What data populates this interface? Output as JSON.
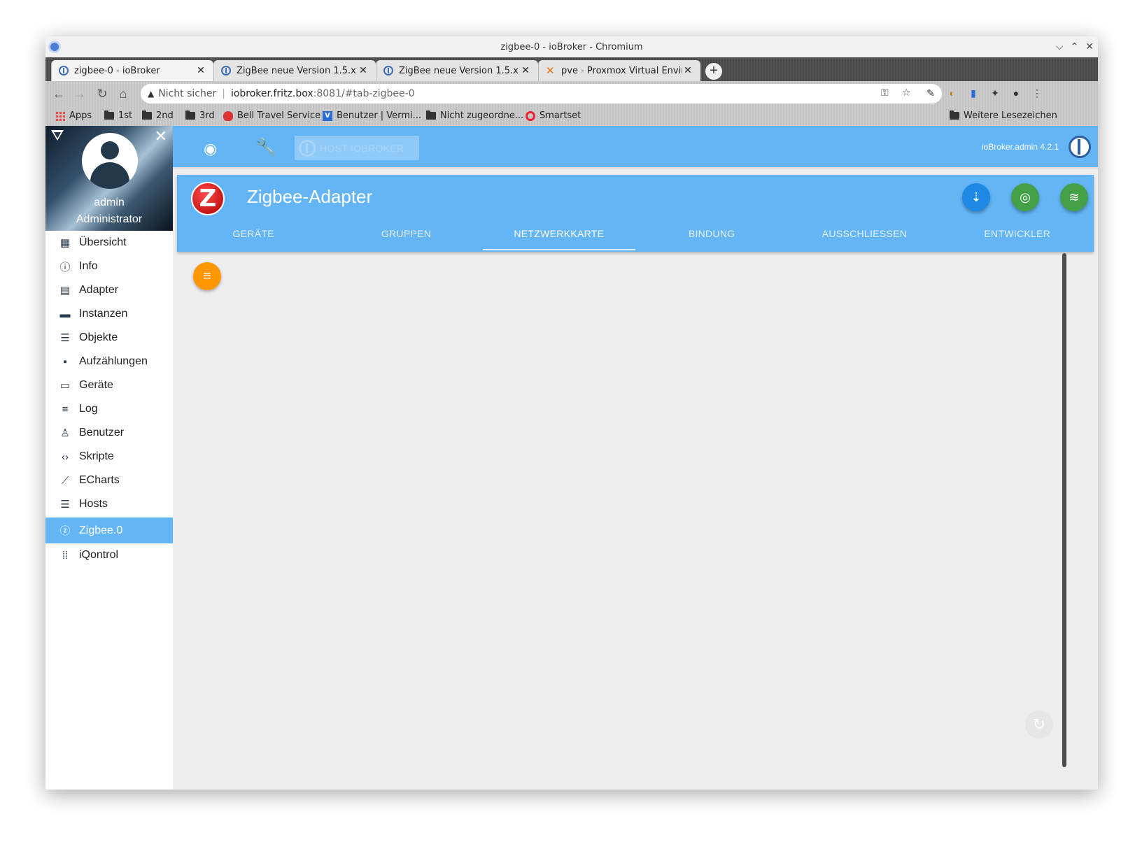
{
  "window": {
    "title": "zigbee-0 - ioBroker - Chromium",
    "controls": [
      "⌵",
      "⌃",
      "✕"
    ]
  },
  "tabs": [
    {
      "title": "zigbee-0 - ioBroker",
      "active": true
    },
    {
      "title": "ZigBee neue Version 1.5.x",
      "active": false
    },
    {
      "title": "ZigBee neue Version 1.5.x",
      "active": false
    },
    {
      "title": "pve - Proxmox Virtual Environ",
      "active": false
    }
  ],
  "omnibox": {
    "security": "Nicht sicher",
    "host": "iobroker.fritz.box",
    "path": ":8081/#tab-zigbee-0"
  },
  "bookmarks": [
    {
      "label": "Apps",
      "icon": "apps-icon"
    },
    {
      "label": "1st",
      "icon": "folder-icon"
    },
    {
      "label": "2nd",
      "icon": "folder-icon"
    },
    {
      "label": "3rd",
      "icon": "folder-icon"
    },
    {
      "label": "Bell Travel Service",
      "icon": "bell-travel-icon"
    },
    {
      "label": "Benutzer | Vermi...",
      "icon": "v-icon"
    },
    {
      "label": "Nicht zugeordne...",
      "icon": "folder-icon"
    },
    {
      "label": "Smartset",
      "icon": "smartset-icon"
    },
    {
      "label": "Weitere Lesezeichen",
      "icon": "folder-icon"
    }
  ],
  "profile": {
    "name": "admin",
    "role": "Administrator"
  },
  "sidebar": {
    "items": [
      {
        "label": "Übersicht",
        "icon": "grid-icon"
      },
      {
        "label": "Info",
        "icon": "info-icon"
      },
      {
        "label": "Adapter",
        "icon": "store-icon"
      },
      {
        "label": "Instanzen",
        "icon": "instances-icon"
      },
      {
        "label": "Objekte",
        "icon": "list-icon"
      },
      {
        "label": "Aufzählungen",
        "icon": "enum-icon"
      },
      {
        "label": "Geräte",
        "icon": "devices-icon"
      },
      {
        "label": "Log",
        "icon": "log-icon"
      },
      {
        "label": "Benutzer",
        "icon": "user-icon"
      },
      {
        "label": "Skripte",
        "icon": "code-icon"
      },
      {
        "label": "ECharts",
        "icon": "chart-icon"
      },
      {
        "label": "Hosts",
        "icon": "hosts-icon"
      },
      {
        "label": "Zigbee.0",
        "icon": "zigbee-icon",
        "active": true
      },
      {
        "label": "iQontrol",
        "icon": "iqontrol-icon"
      }
    ]
  },
  "topbar": {
    "host_button": "HOST IOBROKER",
    "version": "ioBroker.admin 4.2.1"
  },
  "adapter": {
    "title": "Zigbee-Adapter",
    "tabs": [
      "GERÄTE",
      "GRUPPEN",
      "NETZWERKKARTE",
      "BINDUNG",
      "AUSSCHLIESSEN",
      "ENTWICKLER"
    ],
    "active_tab": "NETZWERKKARTE"
  },
  "colors": {
    "header_blue": "#64b5f6",
    "fab_blue": "#1e88e5",
    "fab_green": "#43a047",
    "fab_orange": "#ff9800",
    "zigbee_red": "#d50000"
  }
}
